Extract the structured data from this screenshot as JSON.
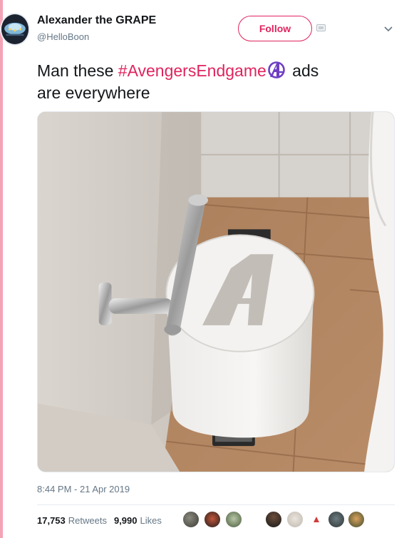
{
  "author": {
    "display_name": "Alexander the GRAPE",
    "handle": "@HelloBoon"
  },
  "header": {
    "follow_label": "Follow"
  },
  "tweet": {
    "text_before": "Man these ",
    "hashtag": "#AvengersEndgame",
    "text_after": " ads",
    "text_line2": "are everywhere",
    "emoji": "avengers-logo-icon"
  },
  "photo": {
    "description_icon": "bathroom-photo"
  },
  "meta": {
    "timestamp": "8:44 PM - 21 Apr 2019"
  },
  "stats": {
    "retweets_count": "17,753",
    "retweets_label": "Retweets",
    "likes_count": "9,990",
    "likes_label": "Likes"
  },
  "colors": {
    "accent": "#e0245e",
    "muted": "#657786",
    "text": "#14171a",
    "rail": "#f3a3b6",
    "emoji_purple": "#6f3fc4"
  }
}
